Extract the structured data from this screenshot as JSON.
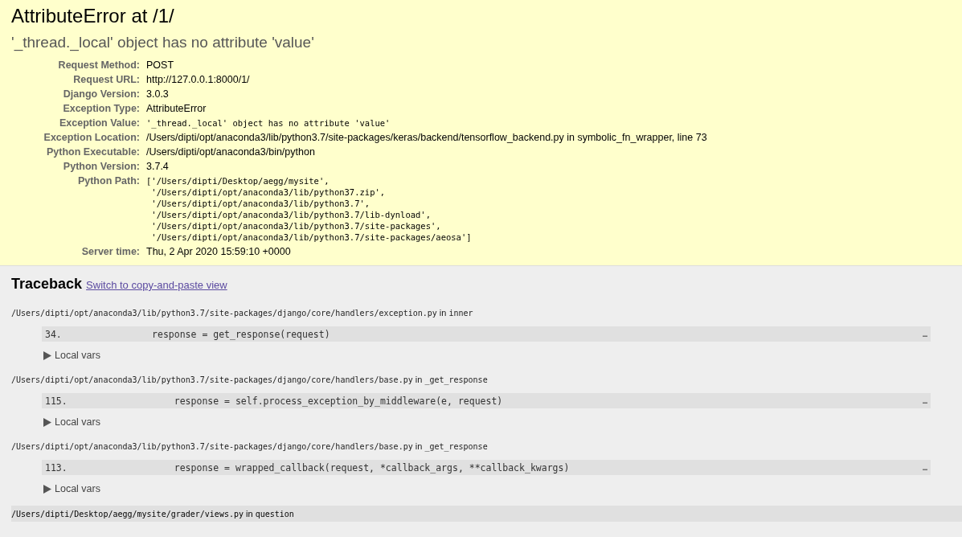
{
  "summary": {
    "title": "AttributeError at /1/",
    "message": "'_thread._local' object has no attribute 'value'",
    "meta": [
      {
        "label": "Request Method:",
        "value": "POST",
        "kind": "text"
      },
      {
        "label": "Request URL:",
        "value": "http://127.0.0.1:8000/1/",
        "kind": "text"
      },
      {
        "label": "Django Version:",
        "value": "3.0.3",
        "kind": "text"
      },
      {
        "label": "Exception Type:",
        "value": "AttributeError",
        "kind": "text"
      },
      {
        "label": "Exception Value:",
        "value": "'_thread._local' object has no attribute 'value'",
        "kind": "code"
      },
      {
        "label": "Exception Location:",
        "value": "/Users/dipti/opt/anaconda3/lib/python3.7/site-packages/keras/backend/tensorflow_backend.py in symbolic_fn_wrapper, line 73",
        "kind": "text"
      },
      {
        "label": "Python Executable:",
        "value": "/Users/dipti/opt/anaconda3/bin/python",
        "kind": "text"
      },
      {
        "label": "Python Version:",
        "value": "3.7.4",
        "kind": "text"
      },
      {
        "label": "Python Path:",
        "value": "['/Users/dipti/Desktop/aegg/mysite',\n '/Users/dipti/opt/anaconda3/lib/python37.zip',\n '/Users/dipti/opt/anaconda3/lib/python3.7',\n '/Users/dipti/opt/anaconda3/lib/python3.7/lib-dynload',\n '/Users/dipti/opt/anaconda3/lib/python3.7/site-packages',\n '/Users/dipti/opt/anaconda3/lib/python3.7/site-packages/aeosa']",
        "kind": "code"
      },
      {
        "label": "Server time:",
        "value": "Thu, 2 Apr 2020 15:59:10 +0000",
        "kind": "text"
      }
    ]
  },
  "traceback": {
    "title": "Traceback",
    "switch_link": "Switch to copy-and-paste view",
    "frames": [
      {
        "kind": "django",
        "file": "/Users/dipti/opt/anaconda3/lib/python3.7/site-packages/django/core/handlers/exception.py",
        "in": "in",
        "function": "inner",
        "line_no": "34.",
        "code": "            response = get_response(request)",
        "more": "…",
        "local_vars": "Local vars"
      },
      {
        "kind": "django",
        "file": "/Users/dipti/opt/anaconda3/lib/python3.7/site-packages/django/core/handlers/base.py",
        "in": "in",
        "function": "_get_response",
        "line_no": "115.",
        "code": "                response = self.process_exception_by_middleware(e, request)",
        "more": "…",
        "local_vars": "Local vars"
      },
      {
        "kind": "django",
        "file": "/Users/dipti/opt/anaconda3/lib/python3.7/site-packages/django/core/handlers/base.py",
        "in": "in",
        "function": "_get_response",
        "line_no": "113.",
        "code": "                response = wrapped_callback(request, *callback_args, **callback_kwargs)",
        "more": "…",
        "local_vars": "Local vars"
      },
      {
        "kind": "user",
        "file": "/Users/dipti/Desktop/aegg/mysite/grader/views.py",
        "in": "in",
        "function": "question"
      }
    ]
  }
}
